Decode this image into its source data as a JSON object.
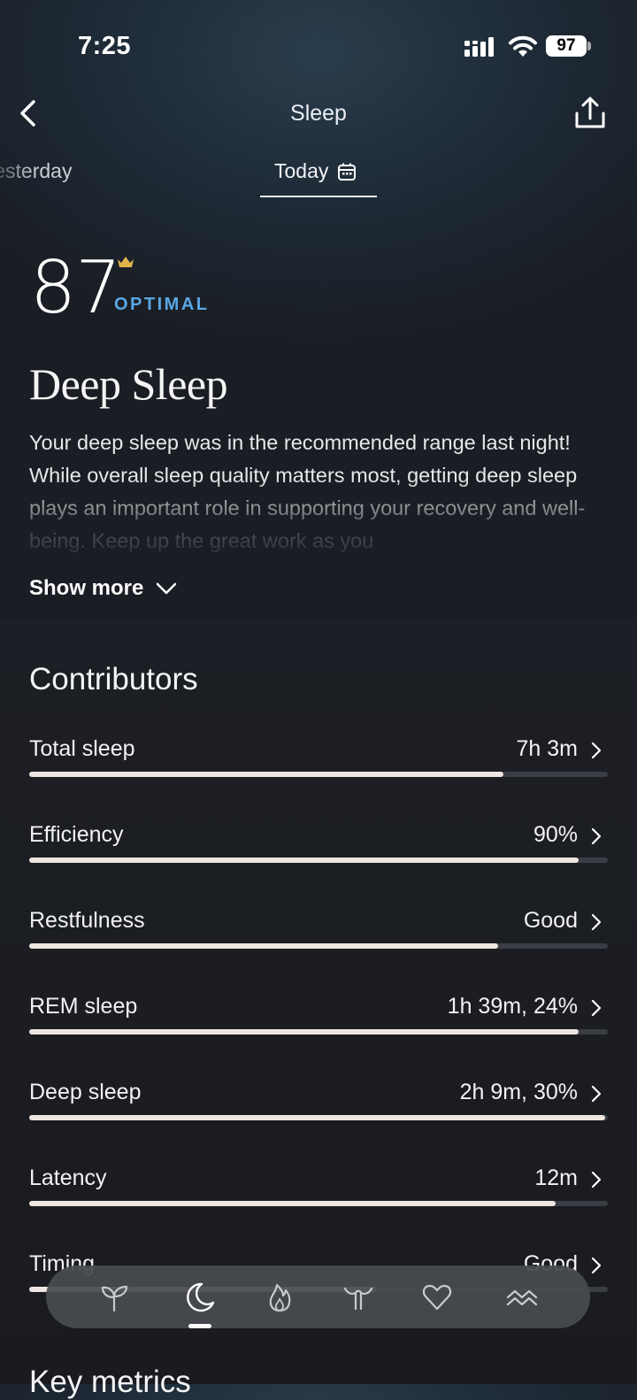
{
  "status_bar": {
    "time": "7:25",
    "battery": "97"
  },
  "header": {
    "title": "Sleep"
  },
  "tabs": {
    "previous": "Yesterday",
    "current": "Today"
  },
  "score": {
    "value": "87",
    "label": "OPTIMAL",
    "label_color": "#5aa7e3",
    "crown_color": "#e0b44a"
  },
  "summary": {
    "heading": "Deep Sleep",
    "description": "Your deep sleep was in the recommended range last night! While overall sleep quality matters most, getting deep sleep plays an important role in supporting your recovery and well-being. Keep up the great work as you",
    "show_more": "Show more"
  },
  "contributors": {
    "heading": "Contributors",
    "items": [
      {
        "label": "Total sleep",
        "value": "7h 3m",
        "level": 0.82
      },
      {
        "label": "Efficiency",
        "value": "90%",
        "level": 0.95
      },
      {
        "label": "Restfulness",
        "value": "Good",
        "level": 0.81
      },
      {
        "label": "REM sleep",
        "value": "1h 39m, 24%",
        "level": 0.95
      },
      {
        "label": "Deep sleep",
        "value": "2h 9m, 30%",
        "level": 0.995
      },
      {
        "label": "Latency",
        "value": "12m",
        "level": 0.91
      },
      {
        "label": "Timing",
        "value": "Good",
        "level": 0.6
      }
    ]
  },
  "key_metrics": {
    "heading": "Key metrics"
  },
  "bottom_nav": {
    "items": [
      "sprout-icon",
      "moon-icon",
      "flame-icon",
      "body-icon",
      "heart-icon",
      "waves-icon"
    ],
    "active": "moon-icon"
  }
}
